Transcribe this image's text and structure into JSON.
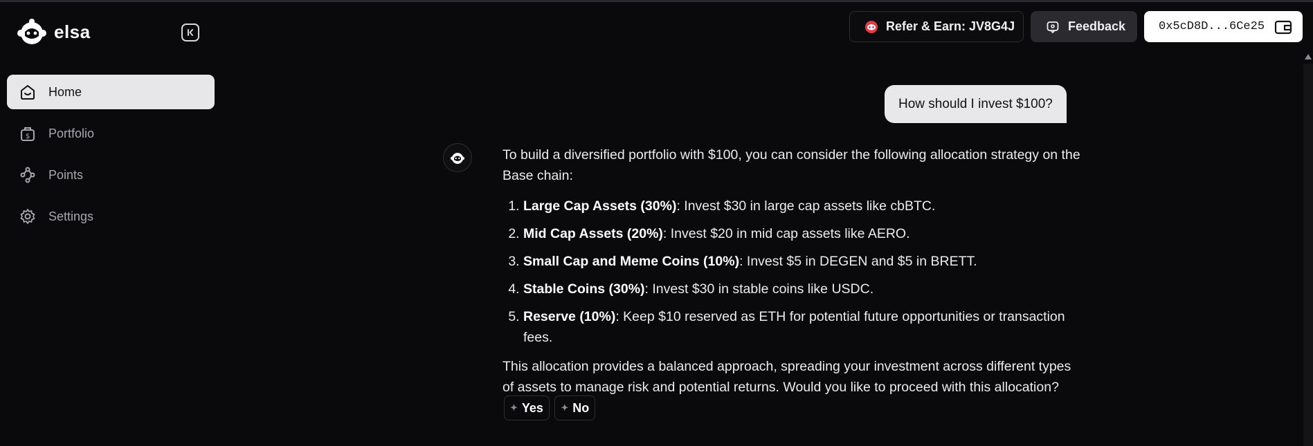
{
  "app": {
    "name": "elsa"
  },
  "sidebar": {
    "items": [
      {
        "label": "Home",
        "icon": "home-icon",
        "active": true
      },
      {
        "label": "Portfolio",
        "icon": "portfolio-icon",
        "active": false
      },
      {
        "label": "Points",
        "icon": "points-icon",
        "active": false
      },
      {
        "label": "Settings",
        "icon": "gear-icon",
        "active": false
      }
    ]
  },
  "header": {
    "refer_label": "Refer & Earn: JV8G4J",
    "feedback_label": "Feedback",
    "wallet_address": "0x5cD8D...6Ce25"
  },
  "chat": {
    "user_message": "How should I invest $100?",
    "bot_intro": "To build a diversified portfolio with $100, you can consider the following allocation strategy on the Base chain:",
    "allocations": [
      {
        "title": "Large Cap Assets (30%)",
        "text": ": Invest $30 in large cap assets like cbBTC."
      },
      {
        "title": "Mid Cap Assets (20%)",
        "text": ": Invest $20 in mid cap assets like AERO."
      },
      {
        "title": "Small Cap and Meme Coins (10%)",
        "text": ": Invest $5 in DEGEN and $5 in BRETT."
      },
      {
        "title": "Stable Coins (30%)",
        "text": ": Invest $30 in stable coins like USDC."
      },
      {
        "title": "Reserve (10%)",
        "text": ": Keep $10 reserved as ETH for potential future opportunities or transaction fees."
      }
    ],
    "bot_outro": "This allocation provides a balanced approach, spreading your investment across different types of assets to manage risk and potential returns. Would you like to proceed with this allocation?",
    "yes_label": "Yes",
    "no_label": "No"
  },
  "colors": {
    "background": "#0a0a0c",
    "active_nav": "#e7e7ea",
    "feedback_bg": "#2a2a2f",
    "wallet_bg": "#ffffff"
  }
}
